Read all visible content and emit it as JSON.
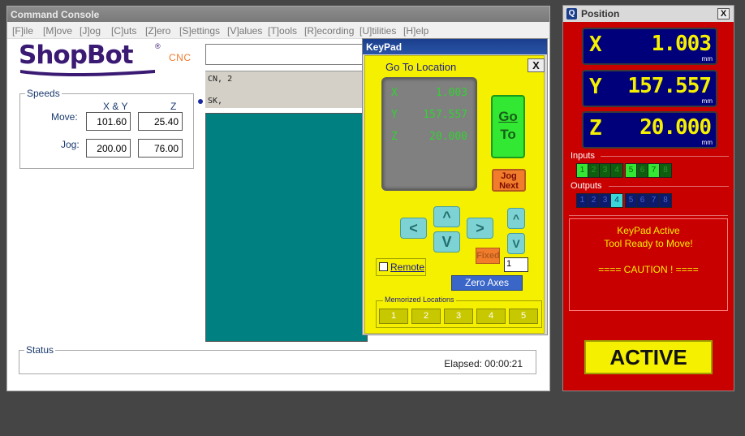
{
  "console": {
    "title": "Command Console",
    "menu": [
      "[F]ile",
      "[M]ove",
      "[J]og",
      "[C]uts",
      "[Z]ero",
      "[S]ettings",
      "[V]alues",
      "[T]ools",
      "[R]ecording",
      "[U]tilities",
      "[H]elp"
    ],
    "logo_text": "ShopBot",
    "logo_reg": "®",
    "logo_cnc": "CNC",
    "speeds": {
      "group_label": "Speeds",
      "col_xy": "X & Y",
      "col_z": "Z",
      "move_label": "Move:",
      "jog_label": "Jog:",
      "move_xy": "101.60",
      "move_z": "25.40",
      "jog_xy": "200.00",
      "jog_z": "76.00"
    },
    "command_input": "",
    "output_lines": [
      "CN, 2",
      "SK,"
    ],
    "status_label": "Status",
    "elapsed": "Elapsed: 00:00:21"
  },
  "keypad": {
    "title": "KeyPad",
    "goto_title": "Go To Location",
    "close_label": "X",
    "lcd": [
      {
        "axis": "X",
        "value": "1.003"
      },
      {
        "axis": "Y",
        "value": "157.557"
      },
      {
        "axis": "Z",
        "value": "20.000"
      }
    ],
    "go_label_1": "Go",
    "go_label_2": "To",
    "jog_next_1": "Jog",
    "jog_next_2": "Next",
    "arrow_left": "<",
    "arrow_right": ">",
    "arrow_up": "^",
    "arrow_down": "V",
    "z_up": "^",
    "z_down": "V",
    "fixed_label": "Fixed",
    "step_value": "1",
    "remote_label": "Remote",
    "zero_axes_label": "Zero Axes",
    "memorized_label": "Memorized Locations",
    "memory_slots": [
      "1",
      "2",
      "3",
      "4",
      "5"
    ]
  },
  "position": {
    "title": "Position",
    "icon_glyph": "Q",
    "close_label": "X",
    "readouts": [
      {
        "axis": "X",
        "value": "1.003",
        "unit": "mm"
      },
      {
        "axis": "Y",
        "value": "157.557",
        "unit": "mm"
      },
      {
        "axis": "Z",
        "value": "20.000",
        "unit": "mm"
      }
    ],
    "inputs_label": "Inputs",
    "inputs": [
      "1",
      "2",
      "3",
      "4",
      "5",
      "6",
      "7",
      "8"
    ],
    "outputs_label": "Outputs",
    "outputs": [
      "1",
      "2",
      "3",
      "4",
      "5",
      "6",
      "7",
      "8"
    ],
    "message": [
      "KeyPad Active",
      "Tool Ready to Move!",
      "",
      "==== CAUTION ! ===="
    ],
    "active_label": "ACTIVE",
    "colors": {
      "panel": "#c80000",
      "readout_bg": "#00007a",
      "readout_text": "#f5f000",
      "input_on": "#32e832",
      "output_on": "#3ad8d8"
    }
  }
}
